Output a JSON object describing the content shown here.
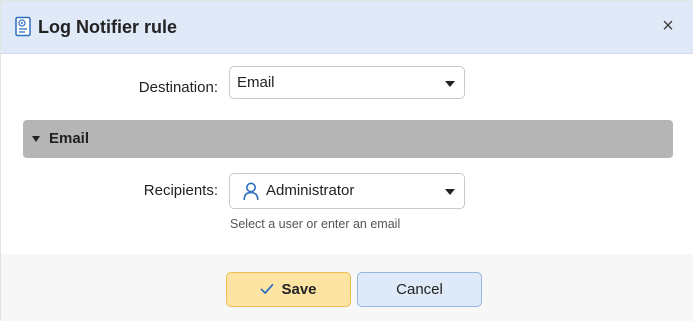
{
  "dialog": {
    "title": "Log Notifier rule",
    "title_icon": "log-document-icon",
    "close_label": "×"
  },
  "form": {
    "destination": {
      "label": "Destination:",
      "value": "Email"
    },
    "section": {
      "label": "Email",
      "expanded": true
    },
    "recipients": {
      "label": "Recipients:",
      "value": "Administrator",
      "icon": "user-icon",
      "hint": "Select a user or enter an email"
    }
  },
  "footer": {
    "save_label": "Save",
    "cancel_label": "Cancel"
  },
  "colors": {
    "titlebar": "#dfe9f7",
    "section_header": "#b5b5b5",
    "save_bg": "#fde4a3",
    "cancel_bg": "#deeaf8",
    "accent_icon": "#2f6fc0"
  }
}
